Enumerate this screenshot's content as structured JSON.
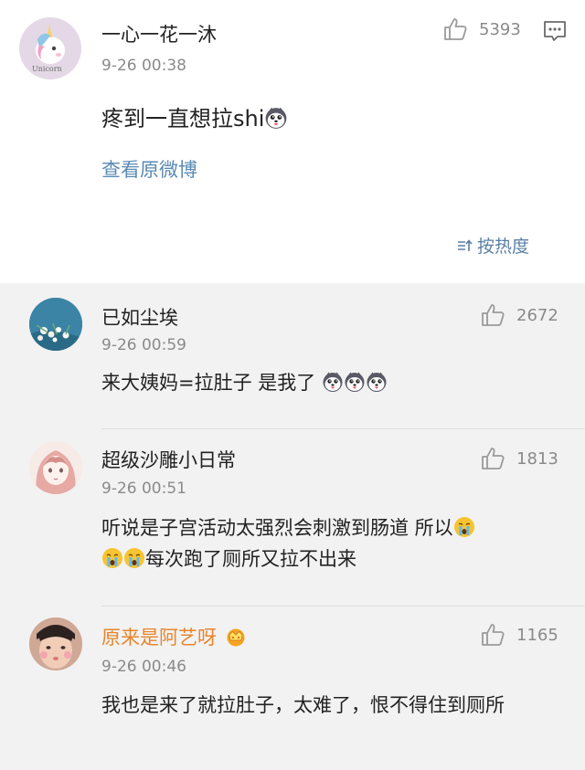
{
  "post": {
    "username": "一心一花一沐",
    "time": "9-26 00:38",
    "like_count": "5393",
    "content": "疼到一直想拉shi",
    "view_original": "查看原微博",
    "sort_label": "按热度",
    "avatar_text": "Unicorn"
  },
  "replies": [
    {
      "username": "已如尘埃",
      "time": "9-26 00:59",
      "like_count": "2672",
      "content": "来大姨妈=拉肚子 是我了"
    },
    {
      "username": "超级沙雕小日常",
      "time": "9-26 00:51",
      "like_count": "1813",
      "content_line1": "听说是子宫活动太强烈会刺激到肠道 所以",
      "content_line2": "每次跑了厕所又拉不出来"
    },
    {
      "username": "原来是阿艺呀",
      "time": "9-26 00:46",
      "like_count": "1165",
      "content": "我也是来了就拉肚子，太难了，恨不得住到厕所"
    }
  ],
  "colors": {
    "link": "#5b8ab4",
    "vip_name": "#e8852c",
    "muted": "#8a8a8a",
    "reply_bg": "#f2f2f2"
  },
  "icons": [
    "thumbs-up-icon",
    "comment-icon",
    "sort-icon",
    "husky-emoji",
    "crying-emoji",
    "crown-badge-icon"
  ]
}
